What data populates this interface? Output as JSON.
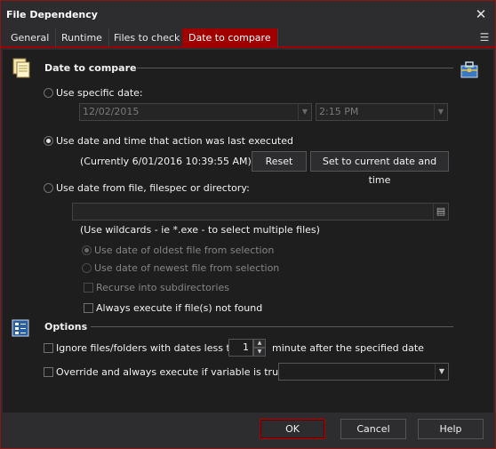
{
  "window": {
    "title": "File Dependency",
    "close_glyph": "✕"
  },
  "tabs": [
    {
      "label": "General"
    },
    {
      "label": "Runtime"
    },
    {
      "label": "Files to check"
    },
    {
      "label": "Date to compare"
    }
  ],
  "active_tab": "Date to compare",
  "tab_menu_glyph": "☰",
  "date_section": {
    "title": "Date to compare",
    "specific_date_label": "Use specific date:",
    "date_value": "12/02/2015",
    "time_value": "2:15 PM",
    "last_executed_label": "Use date and time that action was last executed",
    "currently_text": "(Currently 6/01/2016 10:39:55 AM)",
    "reset_label": "Reset",
    "set_current_label": "Set to current date and time",
    "from_file_label": "Use date from file, filespec or directory:",
    "file_value": "",
    "wildcards_hint": "(Use wildcards - ie *.exe - to select multiple files)",
    "oldest_label": "Use date of oldest file from selection",
    "newest_label": "Use date of newest file from selection",
    "recurse_label": "Recurse into subdirectories",
    "always_execute_label": "Always execute if file(s) not found"
  },
  "options_section": {
    "title": "Options",
    "ignore_label": "Ignore files/folders with dates less than",
    "ignore_value": "1",
    "minute_label": "minute after the specified date",
    "override_label": "Override and always execute if variable is true:",
    "variable_value": ""
  },
  "footer": {
    "ok_label": "OK",
    "cancel_label": "Cancel",
    "help_label": "Help"
  },
  "colors": {
    "accent": "#a00000",
    "background": "#1e1e1e",
    "chrome": "#2d2d30"
  }
}
